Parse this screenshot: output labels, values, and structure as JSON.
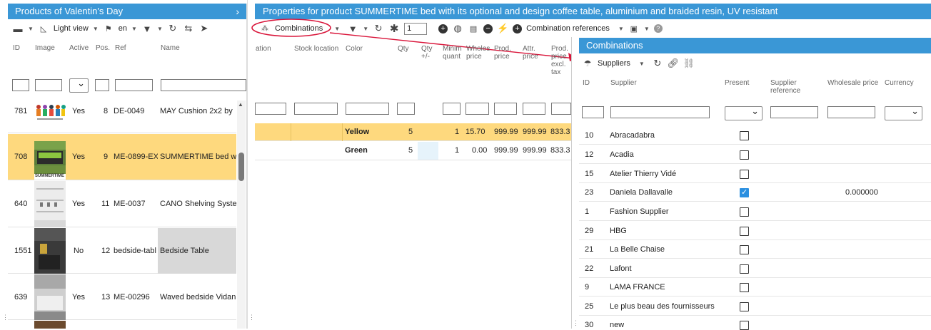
{
  "left_panel": {
    "title": "Products of Valentin's Day",
    "toolbar": {
      "view_label": "Light view",
      "lang_label": "en"
    },
    "columns": [
      "ID",
      "Image",
      "Active",
      "Pos.",
      "Ref",
      "Name"
    ],
    "rows": [
      {
        "id": "781",
        "active": "Yes",
        "pos": "8",
        "ref": "DE-0049",
        "name": "MAY Cushion 2x2 by"
      },
      {
        "id": "708",
        "active": "Yes",
        "pos": "9",
        "ref": "ME-0899-EX",
        "name": "SUMMERTIME bed w"
      },
      {
        "id": "640",
        "active": "Yes",
        "pos": "11",
        "ref": "ME-0037",
        "name": "CANO Shelving Syste"
      },
      {
        "id": "1551",
        "active": "No",
        "pos": "12",
        "ref": "bedside-tabl",
        "name": "Bedside Table"
      },
      {
        "id": "639",
        "active": "Yes",
        "pos": "13",
        "ref": "ME-00296",
        "name": "Waved bedside Vidan"
      }
    ],
    "thumb_caption": "SUMMERTIME"
  },
  "middle_panel": {
    "title": "Properties for product SUMMERTIME bed with its optional and design coffee table, aluminium and braided resin, UV resistant",
    "toolbar": {
      "combinations_label": "Combinations",
      "qty_value": "1",
      "combination_references_label": "Combination references"
    },
    "columns": [
      "ation",
      "Stock location",
      "Color",
      "Qty",
      "Qty +/-",
      "Minim quant",
      "Wholes price",
      "Prod. price",
      "Attr. price",
      "Prod. price excl. tax"
    ],
    "rows": [
      {
        "color": "Yellow",
        "qty": "5",
        "qty_delta": "",
        "min_qty": "1",
        "wholesale": "15.70",
        "prod_price": "999.99",
        "attr_price": "999.99",
        "excl": "833.3"
      },
      {
        "color": "Green",
        "qty": "5",
        "qty_delta": "",
        "min_qty": "1",
        "wholesale": "0.00",
        "prod_price": "999.99",
        "attr_price": "999.99",
        "excl": "833.3"
      }
    ]
  },
  "right_panel": {
    "title": "Combinations",
    "toolbar": {
      "suppliers_label": "Suppliers"
    },
    "columns": [
      "ID",
      "Supplier",
      "Present",
      "Supplier reference",
      "Wholesale price",
      "Currency"
    ],
    "rows": [
      {
        "id": "10",
        "supplier": "Abracadabra",
        "present": false,
        "wholesale": ""
      },
      {
        "id": "12",
        "supplier": "Acadia",
        "present": false,
        "wholesale": ""
      },
      {
        "id": "15",
        "supplier": "Atelier Thierry Vidé",
        "present": false,
        "wholesale": ""
      },
      {
        "id": "23",
        "supplier": "Daniela Dallavalle",
        "present": true,
        "wholesale": "0.000000"
      },
      {
        "id": "1",
        "supplier": "Fashion Supplier",
        "present": false,
        "wholesale": ""
      },
      {
        "id": "29",
        "supplier": "HBG",
        "present": false,
        "wholesale": ""
      },
      {
        "id": "21",
        "supplier": "La Belle Chaise",
        "present": false,
        "wholesale": ""
      },
      {
        "id": "22",
        "supplier": "Lafont",
        "present": false,
        "wholesale": ""
      },
      {
        "id": "9",
        "supplier": "LAMA FRANCE",
        "present": false,
        "wholesale": ""
      },
      {
        "id": "25",
        "supplier": "Le plus beau des fournisseurs",
        "present": false,
        "wholesale": ""
      },
      {
        "id": "30",
        "supplier": "new",
        "present": false,
        "wholesale": ""
      }
    ]
  },
  "colors": {
    "header_blue": "#3a97d6",
    "selected_row": "#fed97e",
    "annotation_red": "#d9153a"
  }
}
